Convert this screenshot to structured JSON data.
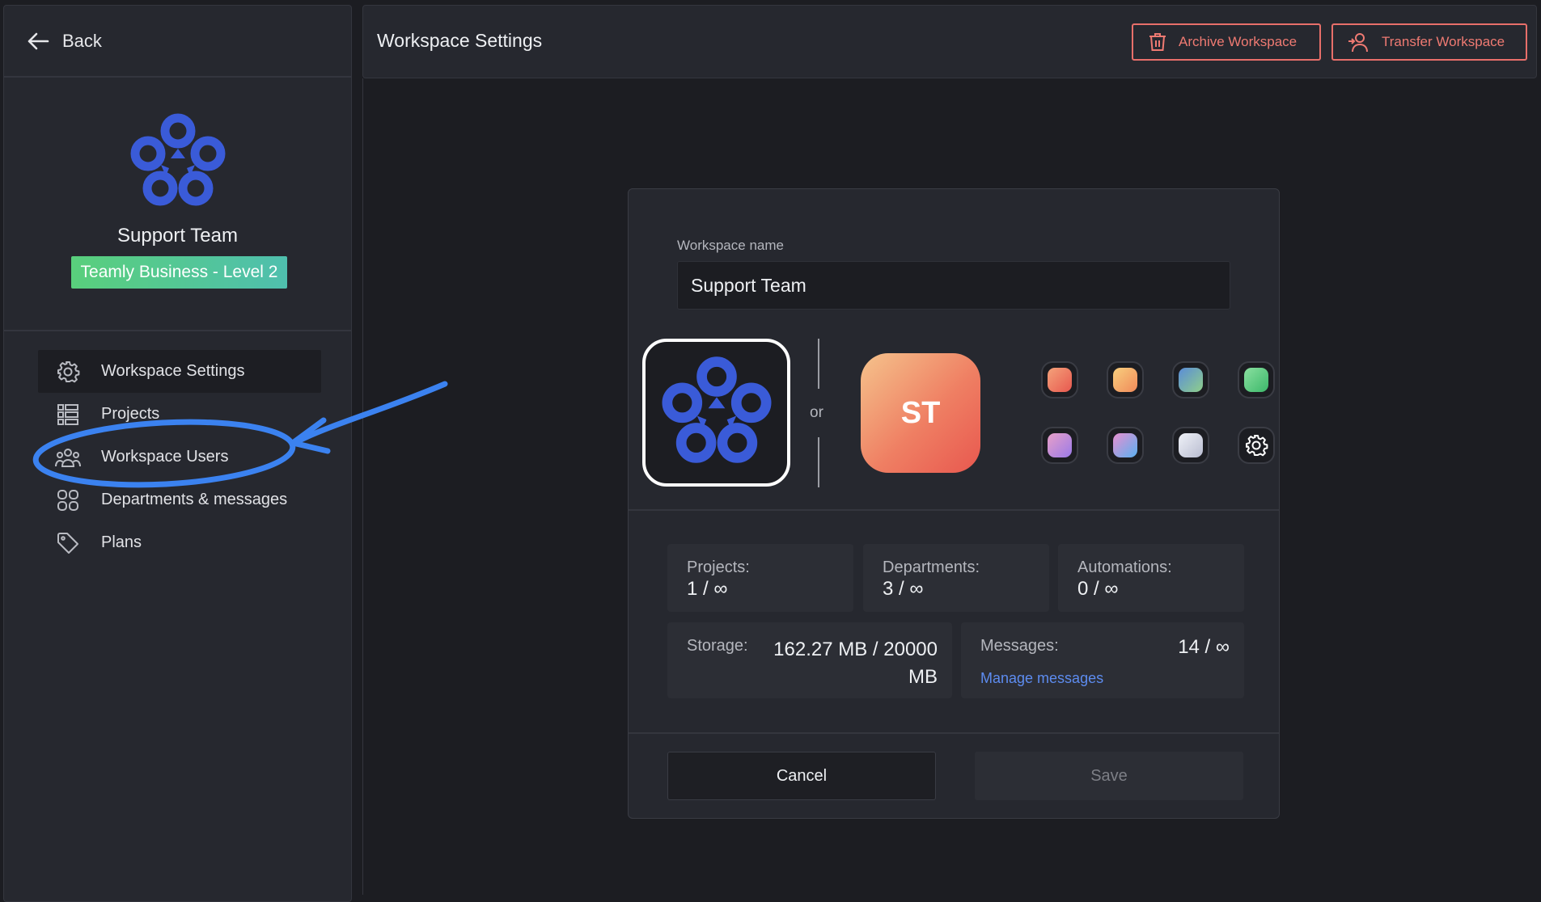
{
  "sidebar": {
    "back_label": "Back",
    "workspace_name": "Support Team",
    "plan_badge": "Teamly Business - Level 2",
    "nav": [
      {
        "label": "Workspace Settings",
        "icon": "gear-icon",
        "active": true
      },
      {
        "label": "Projects",
        "icon": "list-icon"
      },
      {
        "label": "Workspace Users",
        "icon": "users-icon"
      },
      {
        "label": "Departments & messages",
        "icon": "grid-icon"
      },
      {
        "label": "Plans",
        "icon": "tag-icon"
      }
    ]
  },
  "header": {
    "title": "Workspace Settings",
    "archive_label": "Archive Workspace",
    "transfer_label": "Transfer Workspace"
  },
  "form": {
    "name_label": "Workspace name",
    "name_value": "Support Team",
    "or_label": "or",
    "initials": "ST",
    "swatches": [
      "#f0806a",
      "#f6b06a",
      "#6fae9f",
      "#62cf82",
      "#c78ad8",
      "#8a8ef0",
      "#c8ccd8"
    ]
  },
  "stats": {
    "projects_label": "Projects:",
    "projects_value": "1 / ∞",
    "departments_label": "Departments:",
    "departments_value": "3 / ∞",
    "automations_label": "Automations:",
    "automations_value": "0 / ∞",
    "storage_label": "Storage:",
    "storage_value": "162.27 MB / 20000 MB",
    "messages_label": "Messages:",
    "messages_value": "14 / ∞",
    "manage_messages": "Manage messages"
  },
  "actions": {
    "cancel": "Cancel",
    "save": "Save"
  },
  "colors": {
    "accent_red": "#e86f6a",
    "link_blue": "#5d8cf0",
    "annotation_blue": "#3b82f0",
    "logo_blue": "#3a5bd8"
  }
}
